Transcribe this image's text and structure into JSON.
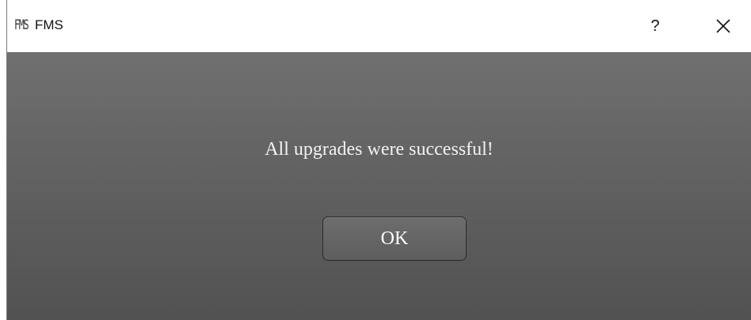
{
  "window": {
    "logo_text": "FMS",
    "title": "FMS",
    "help_label": "?"
  },
  "dialog": {
    "message": "All upgrades were successful!",
    "ok_label": "OK"
  },
  "icons": {
    "app": "fms-logo-icon",
    "help": "question-mark-icon",
    "close": "close-icon"
  },
  "colors": {
    "titlebar": "#ffffff",
    "content_top": "#707070",
    "content_bottom": "#525252",
    "text": "#f2f2f2"
  }
}
